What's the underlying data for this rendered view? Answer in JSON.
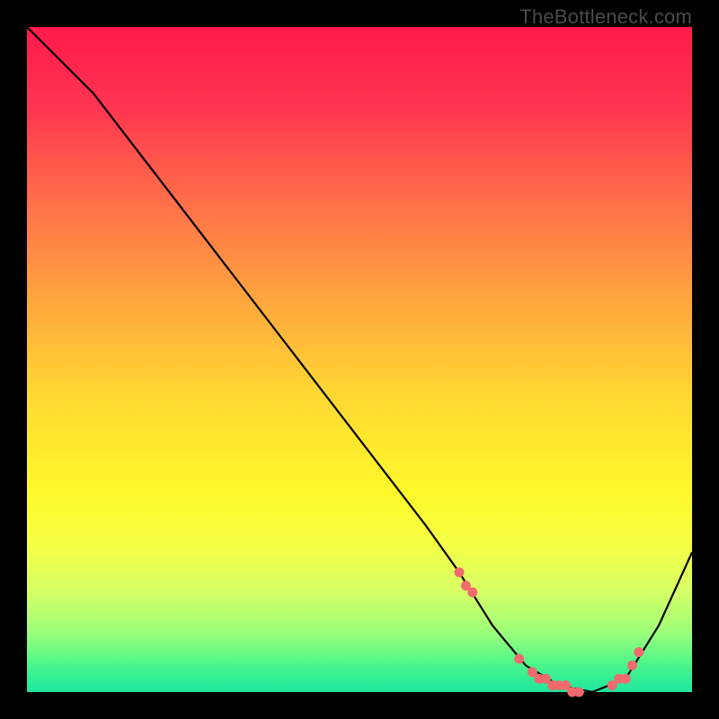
{
  "watermark": {
    "text": "TheBottleneck.com"
  },
  "colors": {
    "background": "#000000",
    "line": "#000000",
    "dot": "#f06a6e",
    "gradient_stops": [
      {
        "pct": 0,
        "color": "#ff1a4b"
      },
      {
        "pct": 12,
        "color": "#ff3550"
      },
      {
        "pct": 25,
        "color": "#ff6a4a"
      },
      {
        "pct": 40,
        "color": "#ffa23f"
      },
      {
        "pct": 55,
        "color": "#ffd733"
      },
      {
        "pct": 70,
        "color": "#fff92a"
      },
      {
        "pct": 78,
        "color": "#f4ff45"
      },
      {
        "pct": 85,
        "color": "#d6ff66"
      },
      {
        "pct": 91,
        "color": "#9dff7a"
      },
      {
        "pct": 96,
        "color": "#49f58b"
      },
      {
        "pct": 100,
        "color": "#1de6a0"
      }
    ]
  },
  "chart_data": {
    "type": "line",
    "title": "",
    "xlabel": "",
    "ylabel": "",
    "xlim": [
      0,
      100
    ],
    "ylim": [
      0,
      100
    ],
    "series": [
      {
        "name": "bottleneck-curve",
        "x": [
          0,
          6,
          10,
          20,
          30,
          40,
          50,
          60,
          65,
          70,
          75,
          80,
          85,
          90,
          95,
          100
        ],
        "values": [
          100,
          94,
          90,
          77,
          64,
          51,
          38,
          25,
          18,
          10,
          4,
          1,
          0,
          2,
          10,
          21
        ]
      }
    ],
    "markers": {
      "name": "highlighted-points",
      "x": [
        65,
        66,
        67,
        74,
        76,
        77,
        78,
        79,
        80,
        81,
        82,
        83,
        88,
        89,
        90,
        91,
        92
      ],
      "values": [
        18,
        16,
        15,
        5,
        3,
        2,
        2,
        1,
        1,
        1,
        0,
        0,
        1,
        2,
        2,
        4,
        6
      ]
    }
  }
}
